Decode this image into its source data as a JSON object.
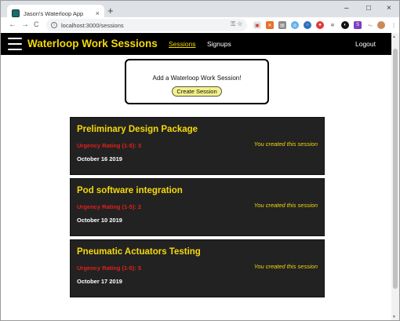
{
  "browser": {
    "tab_title": "Jason's Waterloop App",
    "tab_close": "×",
    "new_tab": "+",
    "url": "localhost:3000/sessions",
    "window_controls": [
      "–",
      "□",
      "×"
    ],
    "nav_icons": [
      "←",
      "→",
      "C"
    ]
  },
  "navbar": {
    "brand": "Waterloop Work Sessions",
    "links": [
      {
        "label": "Sessions",
        "active": true
      },
      {
        "label": "Signups",
        "active": false
      }
    ],
    "logout": "Logout"
  },
  "add_session": {
    "prompt": "Add a Waterloop Work Session!",
    "button_label": "Create Session"
  },
  "sessions": [
    {
      "title": "Preliminary Design Package",
      "urgency": "Urgency Rating (1-5): 3",
      "date": "October 16 2019",
      "owner_note": "You created this session"
    },
    {
      "title": "Pod software integration",
      "urgency": "Urgency Rating (1-5): 2",
      "date": "October 10 2019",
      "owner_note": "You created this session"
    },
    {
      "title": "Pneumatic Actuators Testing",
      "urgency": "Urgency Rating (1-5): 5",
      "date": "October 17 2019",
      "owner_note": "You created this session"
    }
  ],
  "colors": {
    "accent_yellow": "#f5d90a",
    "urgency_red": "#e0201b",
    "card_bg": "#222222",
    "navbar_bg": "#000000"
  }
}
